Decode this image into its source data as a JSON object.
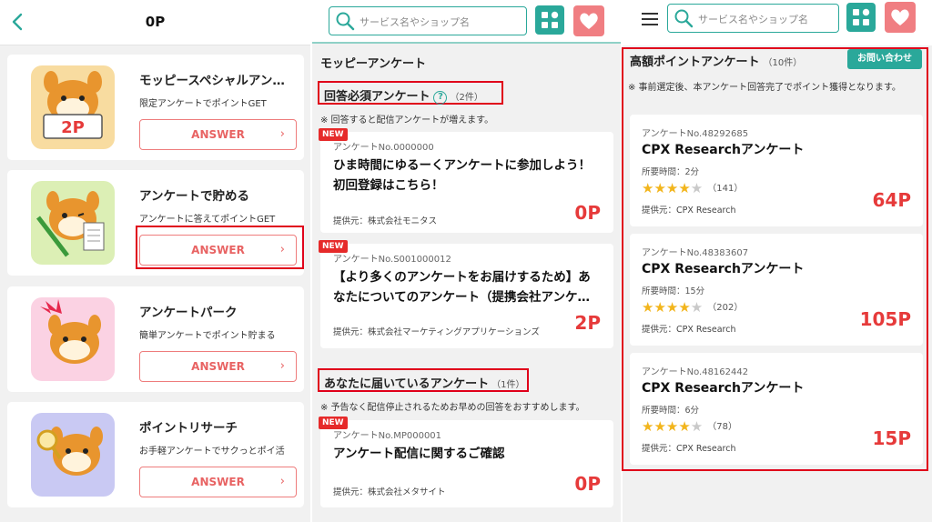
{
  "panel1": {
    "header_title": "0P",
    "cards": [
      {
        "title": "モッピースペシャルアンケート",
        "desc": "限定アンケートでポイントGET",
        "button": "ANSWER",
        "thumb_label": "2P"
      },
      {
        "title": "アンケートで貯める",
        "desc": "アンケートに答えてポイントGET",
        "button": "ANSWER"
      },
      {
        "title": "アンケートパーク",
        "desc": "簡単アンケートでポイント貯まる",
        "button": "ANSWER"
      },
      {
        "title": "ポイントリサーチ",
        "desc": "お手軽アンケートでサクっとポイ活",
        "button": "ANSWER"
      }
    ]
  },
  "search": {
    "placeholder": "サービス名やショップ名"
  },
  "panel2": {
    "section_title": "モッピーアンケート",
    "required": {
      "label": "回答必須アンケート",
      "count": "（2件）",
      "help": "?",
      "note": "※ 回答すると配信アンケートが増えます。"
    },
    "delivered": {
      "label": "あなたに届いているアンケート",
      "count": "（1件）",
      "note": "※ 予告なく配信停止されるためお早めの回答をおすすめします。"
    },
    "surveys": [
      {
        "badge": "NEW",
        "no": "アンケートNo.0000000",
        "title": "ひま時間にゆるーくアンケートに参加しよう！初回登録はこちら！",
        "provider": "提供元：株式会社モニタス",
        "points": "0P"
      },
      {
        "badge": "NEW",
        "no": "アンケートNo.S001000012",
        "title": "【より多くのアンケートをお届けするため】あなたについてのアンケート（提携会社アンケ…",
        "provider": "提供元：株式会社マーケティングアプリケーションズ",
        "points": "2P"
      },
      {
        "badge": "NEW",
        "no": "アンケートNo.MP000001",
        "title": "アンケート配信に関するご確認",
        "provider": "提供元：株式会社メタサイト",
        "points": "0P"
      }
    ]
  },
  "panel3": {
    "title": "高額ポイントアンケート",
    "count": "（10件）",
    "contact": "お問い合わせ",
    "note": "※ 事前選定後、本アンケート回答完了でポイント獲得となります。",
    "surveys": [
      {
        "no": "アンケートNo.48292685",
        "title": "CPX Researchアンケート",
        "time": "所要時間：2分",
        "stars": 4,
        "reviews": "（141）",
        "provider": "提供元：CPX Research",
        "points": "64P"
      },
      {
        "no": "アンケートNo.48383607",
        "title": "CPX Researchアンケート",
        "time": "所要時間：15分",
        "stars": 4,
        "reviews": "（202）",
        "provider": "提供元：CPX Research",
        "points": "105P"
      },
      {
        "no": "アンケートNo.48162442",
        "title": "CPX Researchアンケート",
        "time": "所要時間：6分",
        "stars": 4,
        "reviews": "（78）",
        "provider": "提供元：CPX Research",
        "points": "15P"
      }
    ]
  },
  "colors": {
    "teal": "#2aa89a",
    "pink": "#f07e82",
    "red": "#e63a3a",
    "highlight": "#e0001a"
  },
  "icons": [
    "back-icon",
    "search-icon",
    "grid-icon",
    "heart-icon",
    "menu-icon",
    "help-icon",
    "chevron-right-icon",
    "star-icon"
  ]
}
